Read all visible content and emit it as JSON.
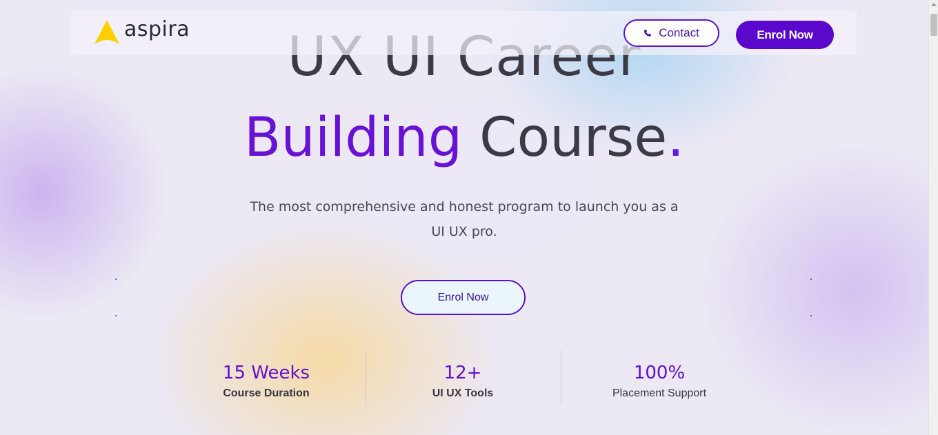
{
  "brand": {
    "name": "aspira",
    "logo_color": "#FFD000"
  },
  "nav": {
    "contact_label": "Contact",
    "enrol_label": "Enrol Now",
    "contact_icon": "phone-icon"
  },
  "hero": {
    "line1": "UX UI Career",
    "line2_accent": "Building",
    "line2_rest": " Course",
    "line2_dot": ".",
    "subtitle_line1": "The most comprehensive and honest program to launch you as a",
    "subtitle_line2": "UI UX pro.",
    "cta_label": "Enrol Now"
  },
  "stats": [
    {
      "value": "15 Weeks",
      "label": "Course Duration"
    },
    {
      "value": "12+",
      "label": "UI UX Tools"
    },
    {
      "value": "100%",
      "label": "Placement Support"
    }
  ],
  "colors": {
    "accent": "#6812D6",
    "button": "#5A08CC",
    "text": "#3C3A44"
  }
}
